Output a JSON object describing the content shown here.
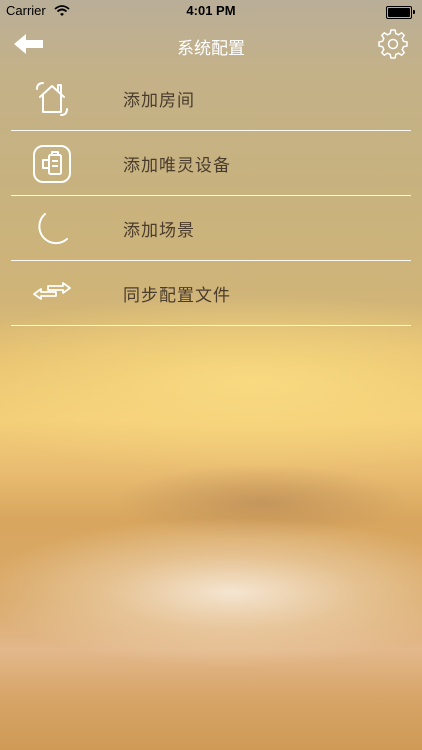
{
  "status_bar": {
    "carrier": "Carrier",
    "time": "4:01 PM",
    "battery_level": 1.0
  },
  "nav_bar": {
    "title": "系统配置",
    "back_icon": "back-arrow-icon",
    "settings_icon": "gear-icon"
  },
  "menu": {
    "items": [
      {
        "label": "添加房间",
        "icon": "room-icon"
      },
      {
        "label": "添加唯灵设备",
        "icon": "device-icon"
      },
      {
        "label": "添加场景",
        "icon": "moon-icon"
      },
      {
        "label": "同步配置文件",
        "icon": "sync-arrows-icon"
      }
    ]
  },
  "colors": {
    "label_text": "#4a3c2c",
    "title_text": "#ffffff",
    "divider": "#ffffff"
  }
}
